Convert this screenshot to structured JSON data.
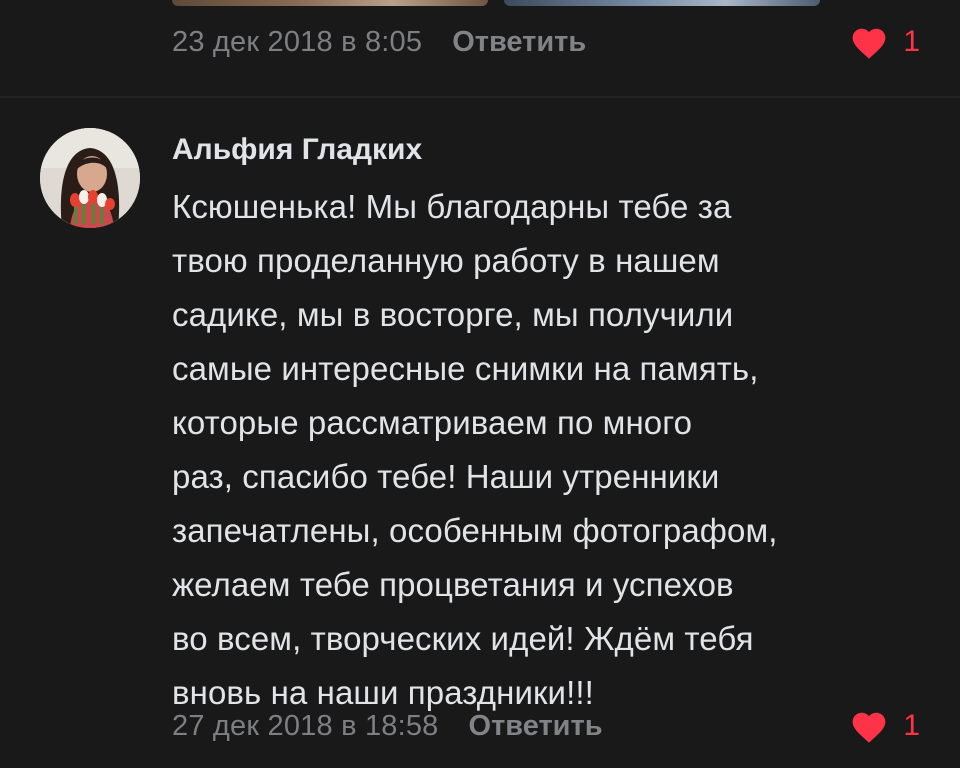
{
  "previous_comment": {
    "date": "23 дек 2018 в 8:05",
    "reply_label": "Ответить",
    "likes": "1"
  },
  "comment": {
    "author": "Альфия Гладких",
    "text_lines": [
      "Ксюшенька! Мы благодарны тебе за",
      "твою проделанную работу в нашем",
      "садике, мы в восторге, мы получили",
      "самые интересные снимки на память,",
      "которые рассматриваем по много",
      "раз, спасибо тебе! Наши утренники",
      "запечатлены, особенным фотографом,",
      "желаем тебе процветания и успехов",
      "во всем, творческих идей! Ждём тебя",
      "вновь на наши праздники!!!"
    ],
    "date": "27 дек 2018 в 18:58",
    "reply_label": "Ответить",
    "likes": "1"
  },
  "colors": {
    "background": "#19191a",
    "text": "#e1e3e6",
    "secondary": "#828387",
    "like_red": "#ff3347"
  },
  "icons": {
    "like": "heart-icon",
    "avatar": "user-avatar-photo"
  }
}
